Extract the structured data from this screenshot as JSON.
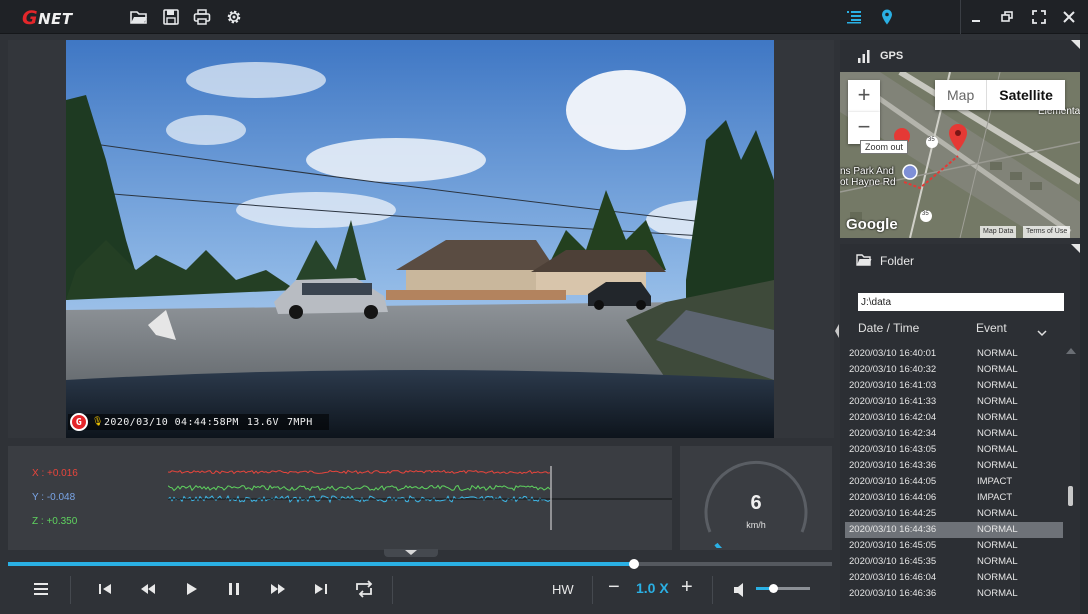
{
  "app": {
    "logo_g": "G",
    "logo_text": "NET"
  },
  "toolbar": {
    "icons": [
      "open-folder-icon",
      "save-icon",
      "print-icon",
      "settings-icon"
    ],
    "right_icons": [
      "list-view-icon",
      "map-pin-icon",
      "minimize-icon",
      "restore-icon",
      "fullscreen-icon",
      "close-icon"
    ]
  },
  "video": {
    "overlay": {
      "logo_letter": "G",
      "datetime": "2020/03/10 04:44:58PM",
      "voltage": "13.6V",
      "speed": "7MPH"
    }
  },
  "gsensor": {
    "x_label": "X : +0.016",
    "y_label": "Y : -0.048",
    "z_label": "Z : +0.350",
    "colors": {
      "x": "#e8453c",
      "y": "#3fb8e8",
      "z": "#5fd35f"
    }
  },
  "speedometer": {
    "value": "6",
    "unit": "km/h",
    "fill_fraction": 0.03
  },
  "playback": {
    "progress": 0.76,
    "hw_label": "HW",
    "rate": "1.0 X",
    "minus": "−",
    "plus": "+",
    "volume": 0.32
  },
  "gps": {
    "title": "GPS",
    "map": {
      "zoom_in": "+",
      "zoom_out": "−",
      "zoom_out_tooltip": "Zoom out",
      "map_option": "Map",
      "satellite_option": "Satellite",
      "place_label_line1": "ns Park And",
      "place_label_line2": "ot Hayne Rd",
      "place_label_right": "Elementa",
      "road_marker_1": "35",
      "road_marker_2": "35",
      "google": "Google",
      "map_data": "Map Data",
      "terms": "Terms of Use"
    }
  },
  "folder": {
    "title": "Folder",
    "path": "J:\\data",
    "col_datetime": "Date / Time",
    "col_event": "Event",
    "rows": [
      {
        "dt": "2020/03/10 16:40:01",
        "ev": "NORMAL"
      },
      {
        "dt": "2020/03/10 16:40:32",
        "ev": "NORMAL"
      },
      {
        "dt": "2020/03/10 16:41:03",
        "ev": "NORMAL"
      },
      {
        "dt": "2020/03/10 16:41:33",
        "ev": "NORMAL"
      },
      {
        "dt": "2020/03/10 16:42:04",
        "ev": "NORMAL"
      },
      {
        "dt": "2020/03/10 16:42:34",
        "ev": "NORMAL"
      },
      {
        "dt": "2020/03/10 16:43:05",
        "ev": "NORMAL"
      },
      {
        "dt": "2020/03/10 16:43:36",
        "ev": "NORMAL"
      },
      {
        "dt": "2020/03/10 16:44:05",
        "ev": "IMPACT"
      },
      {
        "dt": "2020/03/10 16:44:06",
        "ev": "IMPACT"
      },
      {
        "dt": "2020/03/10 16:44:25",
        "ev": "NORMAL"
      },
      {
        "dt": "2020/03/10 16:44:36",
        "ev": "NORMAL",
        "selected": true
      },
      {
        "dt": "2020/03/10 16:45:05",
        "ev": "NORMAL"
      },
      {
        "dt": "2020/03/10 16:45:35",
        "ev": "NORMAL"
      },
      {
        "dt": "2020/03/10 16:46:04",
        "ev": "NORMAL"
      },
      {
        "dt": "2020/03/10 16:46:36",
        "ev": "NORMAL"
      }
    ]
  },
  "colors": {
    "accent": "#2ab0e4",
    "brand": "#e3262a",
    "impact": "#e6e6e6"
  }
}
